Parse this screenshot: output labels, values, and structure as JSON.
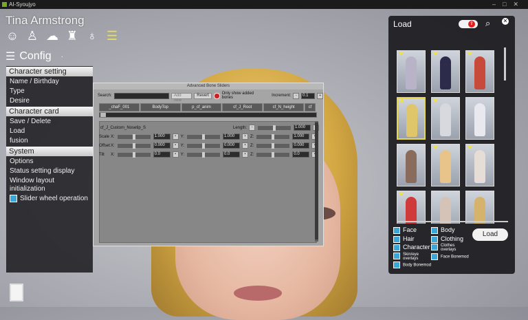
{
  "window": {
    "title": "AI-Syoujyo"
  },
  "character": {
    "name": "Tina Armstrong"
  },
  "category_icons": [
    {
      "name": "face-icon",
      "glyph": "☺"
    },
    {
      "name": "body-icon",
      "glyph": "♙"
    },
    {
      "name": "hair-icon",
      "glyph": "☁"
    },
    {
      "name": "clothes-icon",
      "glyph": "♜"
    },
    {
      "name": "accessory-icon",
      "glyph": "♁"
    },
    {
      "name": "config-list-icon",
      "glyph": "☰",
      "active": true
    }
  ],
  "config": {
    "label": "Config"
  },
  "menu": {
    "sections": [
      {
        "title": "Character setting",
        "items": [
          "Name / Birthday",
          "Type",
          "Desire"
        ]
      },
      {
        "title": "Character card",
        "items": [
          "Save / Delete",
          "Load",
          "fusion"
        ]
      },
      {
        "title": "System",
        "items": [
          "Options",
          "Status setting display",
          "Window layout initialization"
        ]
      }
    ],
    "checkbox_item": "Slider wheel operation"
  },
  "abs": {
    "title": "Advanced Bone Sliders",
    "search_label": "Search:",
    "add_new": "Add new",
    "revert": "Revert",
    "only_added": "Only show added bones",
    "increment_label": "Increment:",
    "increment_value": "0.1",
    "tabs": [
      "_chaF_001",
      "BodyTop",
      "p_cf_anim",
      "cf_J_Root",
      "cf_N_height",
      "cf"
    ],
    "bone_name": "cf_J_Custom_Nosetip_S",
    "length_label": "Length:",
    "length_value": "1.000",
    "rows": [
      {
        "label": "Scale",
        "x": "1.000",
        "y": "1.000",
        "z": "1.000"
      },
      {
        "label": "Offset",
        "x": "0.000",
        "y": "0.000",
        "z": "0.000"
      },
      {
        "label": "Tilt",
        "x": "0.0",
        "y": "0.0",
        "z": "0.0"
      }
    ],
    "axis_x": "X:",
    "axis_y": "Y:",
    "axis_z": "Z:"
  },
  "load_panel": {
    "title": "Load",
    "load_button": "Load",
    "filters": {
      "face": "Face",
      "body": "Body",
      "hair": "Hair",
      "clothing": "Clothing",
      "character": "Character",
      "clothes_overlays": "Clothes overlays",
      "skin_eye_overlays": "Skin/eye overlays",
      "face_bonemod": "Face Bonemod",
      "body_bonemod": "Body Bonemod"
    },
    "cards": [
      {
        "star": "★",
        "color": "#b9b3c7"
      },
      {
        "star": "★",
        "color": "#2c2c4a"
      },
      {
        "star": "★",
        "color": "#c84a3a"
      },
      {
        "star": "★",
        "color": "#e0c66a",
        "selected": true
      },
      {
        "star": "★",
        "color": "#d8d8df"
      },
      {
        "star": "",
        "color": "#e8e8ee"
      },
      {
        "star": "",
        "color": "#8a6c5c"
      },
      {
        "star": "★",
        "color": "#e8c48a"
      },
      {
        "star": "★",
        "color": "#e6ddd6"
      },
      {
        "star": "★",
        "color": "#cf3b3b"
      },
      {
        "star": "",
        "color": "#d4c3b6"
      },
      {
        "star": "",
        "color": "#d6b36c"
      }
    ]
  }
}
